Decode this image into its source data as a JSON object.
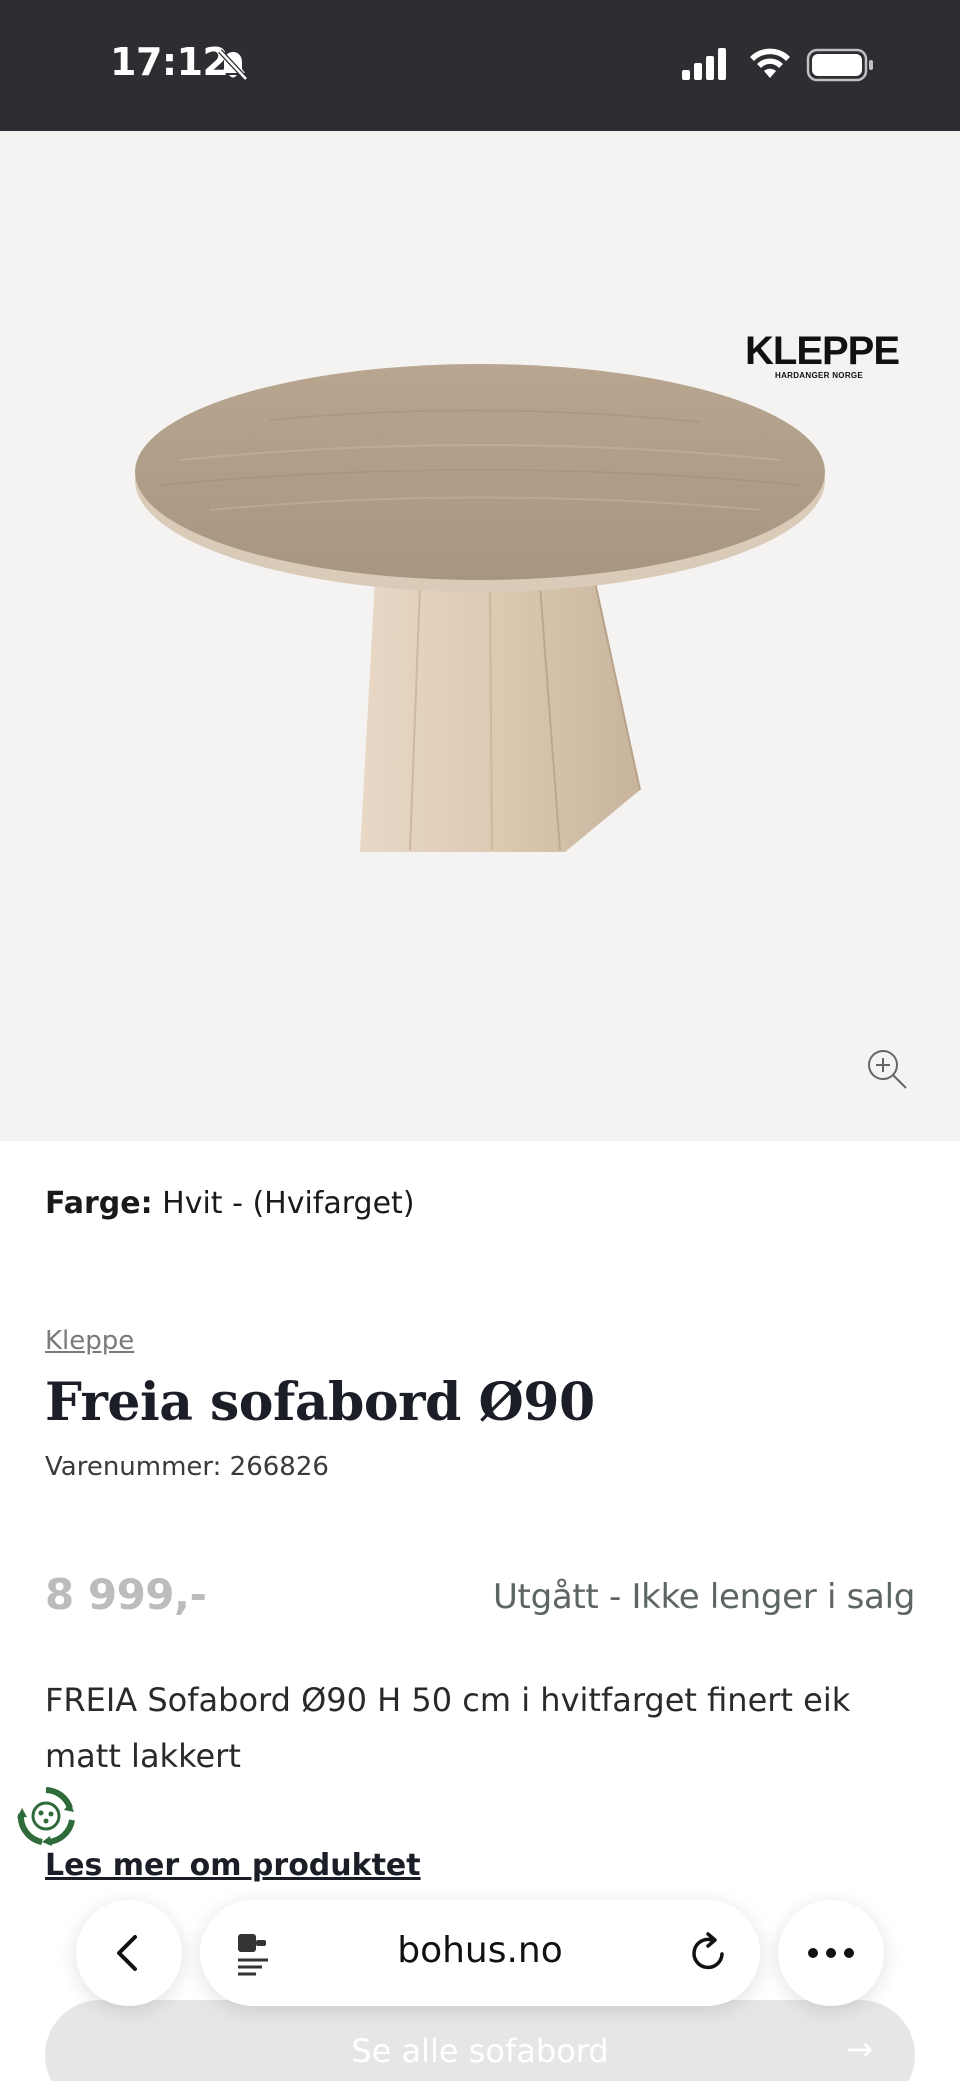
{
  "status_bar": {
    "time": "17:12",
    "icons": [
      "bell-slash-icon",
      "cellular-signal-icon",
      "wifi-icon",
      "battery-icon"
    ]
  },
  "product_image": {
    "brand_logo": "KLEPPE",
    "brand_logo_sub": "HARDANGER NORGE",
    "zoom_icon": "zoom-in-icon"
  },
  "product": {
    "color_label": "Farge:",
    "color_value": "Hvit - (Hvifarget)",
    "brand": "Kleppe",
    "title": "Freia sofabord Ø90",
    "sku": "Varenummer: 266826",
    "price": "8 999,-",
    "availability": "Utgått - Ikke lenger i salg",
    "description": "FREIA Sofabord Ø90 H 50 cm i hvitfarget finert eik matt lakkert",
    "read_more": "Les mer om produktet",
    "see_all": "Se alle sofabord",
    "see_all_arrow": "→"
  },
  "browser": {
    "url": "bohus.no",
    "icons": [
      "back-icon",
      "reader-icon",
      "reload-icon",
      "more-icon"
    ]
  },
  "colors": {
    "status_bar_bg": "#2e2e32",
    "image_bg": "#f4f3f1",
    "title": "#1b1e27",
    "price_muted": "#bcbcbc",
    "availability": "#5d6565",
    "recycle_green": "#2f6b3a"
  }
}
